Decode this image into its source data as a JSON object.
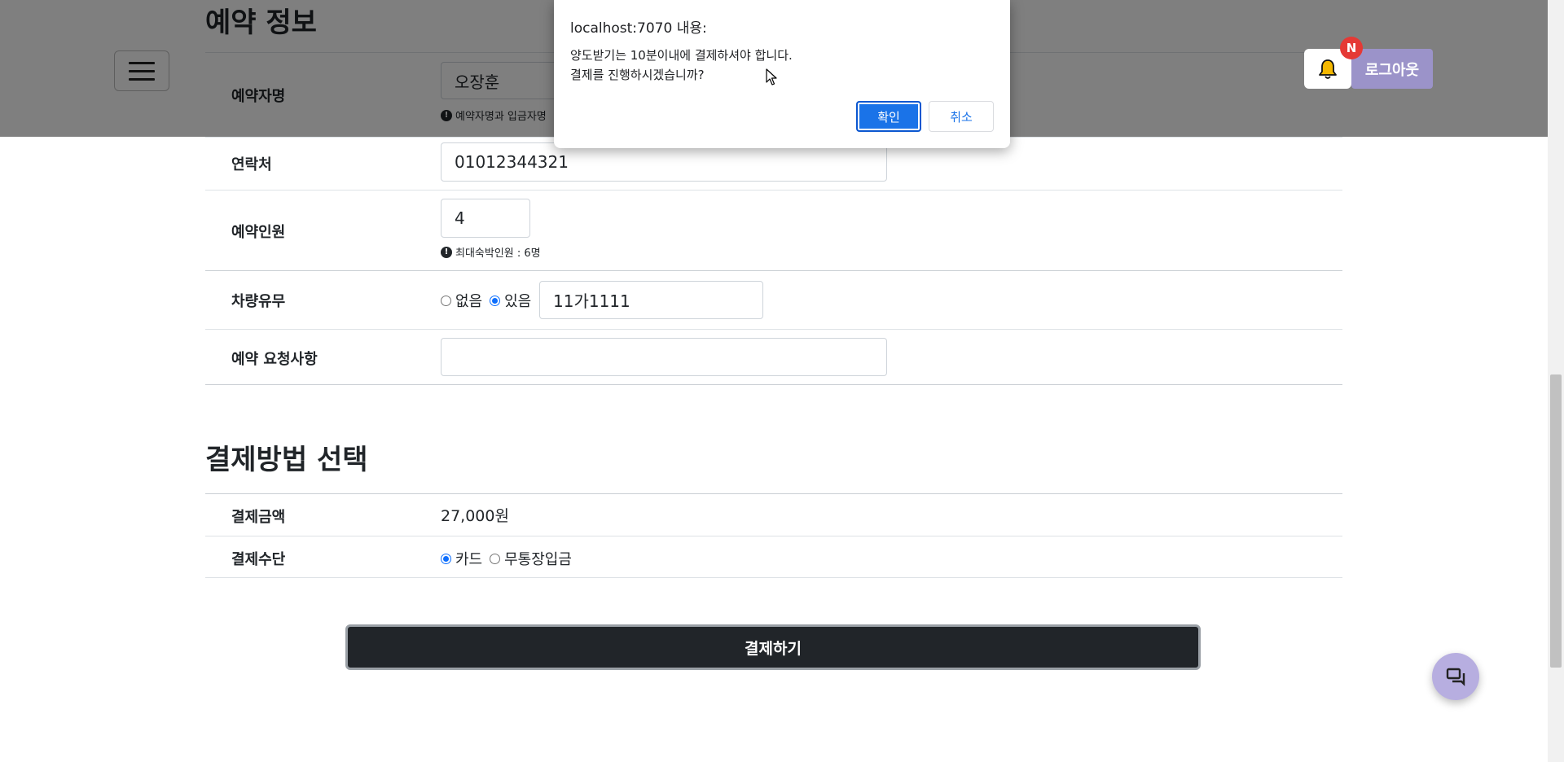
{
  "navbar": {
    "menu_icon": "hamburger-icon",
    "bell_icon": "bell-icon",
    "notification_badge": "N",
    "logout_label": "로그아웃"
  },
  "reservation": {
    "section_title": "예약 정보",
    "name_label": "예약자명",
    "name_value": "오장훈",
    "name_hint": "예약자명과 입금자명",
    "contact_label": "연락처",
    "contact_value": "01012344321",
    "guests_label": "예약인원",
    "guests_value": "4",
    "guests_hint": "최대숙박인원 : 6명",
    "vehicle_label": "차량유무",
    "vehicle_options": [
      "없음",
      "있음"
    ],
    "vehicle_selected": "있음",
    "vehicle_number": "11가1111",
    "request_label": "예약 요청사항",
    "request_value": ""
  },
  "payment": {
    "section_title": "결제방법 선택",
    "amount_label": "결제금액",
    "amount_value": "27,000원",
    "method_label": "결제수단",
    "method_options": [
      "카드",
      "무통장입금"
    ],
    "method_selected": "카드",
    "submit_label": "결제하기"
  },
  "dialog": {
    "title": "localhost:7070 내용:",
    "message_line1": "양도받기는 10분이내에 결제하셔야 합니다.",
    "message_line2": "결제를 진행하시겠습니까?",
    "ok_label": "확인",
    "cancel_label": "취소"
  },
  "chat": {
    "icon": "chat-icon"
  },
  "colors": {
    "primary": "#0d6efd",
    "dark_button": "#212529",
    "logout_bg": "#9b93c9",
    "badge": "#e53935",
    "chat_fab": "#b7aee0"
  }
}
